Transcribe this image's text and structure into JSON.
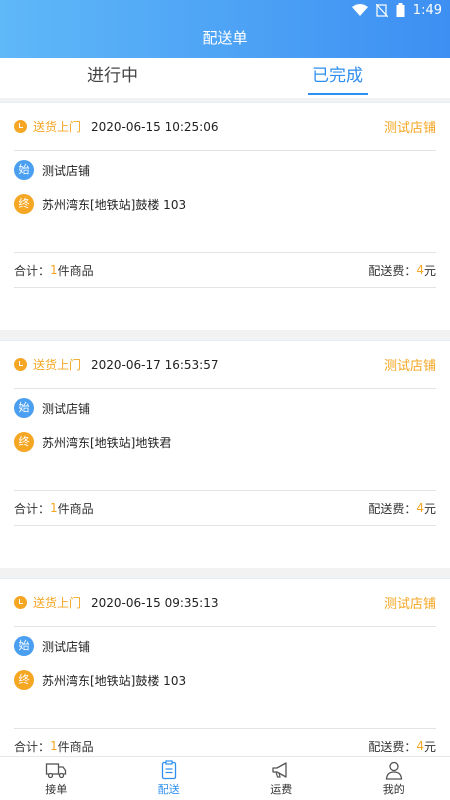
{
  "status_bar": {
    "time": "1:49"
  },
  "header": {
    "title": "配送单"
  },
  "tabs": [
    {
      "label": "进行中"
    },
    {
      "label": "已完成"
    }
  ],
  "orders": [
    {
      "type": "送货上门",
      "time": "2020-06-15 10:25:06",
      "shop": "测试店铺",
      "start_badge": "始",
      "start_addr": "测试店铺",
      "end_badge": "终",
      "end_addr": "苏州湾东[地铁站]鼓楼 103",
      "total_prefix": "合计：",
      "count": "1",
      "count_suffix": "件商品",
      "fee_label": "配送费：",
      "fee_value": "4",
      "fee_unit": "元"
    },
    {
      "type": "送货上门",
      "time": "2020-06-17 16:53:57",
      "shop": "测试店铺",
      "start_badge": "始",
      "start_addr": "测试店铺",
      "end_badge": "终",
      "end_addr": "苏州湾东[地铁站]地铁君",
      "total_prefix": "合计：",
      "count": "1",
      "count_suffix": "件商品",
      "fee_label": "配送费：",
      "fee_value": "4",
      "fee_unit": "元"
    },
    {
      "type": "送货上门",
      "time": "2020-06-15 09:35:13",
      "shop": "测试店铺",
      "start_badge": "始",
      "start_addr": "测试店铺",
      "end_badge": "终",
      "end_addr": "苏州湾东[地铁站]鼓楼 103",
      "total_prefix": "合计：",
      "count": "1",
      "count_suffix": "件商品",
      "fee_label": "配送费：",
      "fee_value": "4",
      "fee_unit": "元"
    }
  ],
  "tabbar": [
    {
      "label": "接单",
      "icon": "truck-icon"
    },
    {
      "label": "配送",
      "icon": "clipboard-icon"
    },
    {
      "label": "运费",
      "icon": "megaphone-icon"
    },
    {
      "label": "我的",
      "icon": "user-icon"
    }
  ],
  "colors": {
    "accent": "#2f8ff0",
    "orange": "#f5a623"
  }
}
